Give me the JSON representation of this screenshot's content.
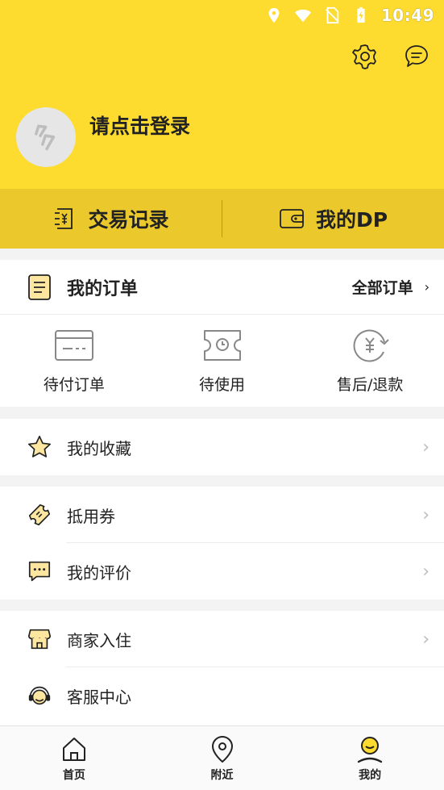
{
  "status_bar": {
    "time": "10:49"
  },
  "header": {
    "login_prompt": "请点击登录"
  },
  "quick_bar": {
    "left_label": "交易记录",
    "right_label": "我的DP"
  },
  "orders": {
    "title": "我的订单",
    "all_label": "全部订单",
    "items": [
      {
        "label": "待付订单",
        "icon": "card-icon"
      },
      {
        "label": "待使用",
        "icon": "ticket-clock-icon"
      },
      {
        "label": "售后/退款",
        "icon": "refund-icon"
      }
    ]
  },
  "menu": {
    "favorites": "我的收藏",
    "vouchers": "抵用券",
    "reviews": "我的评价",
    "merchant": "商家入住",
    "service": "客服中心"
  },
  "tabbar": {
    "home": "首页",
    "nearby": "附近",
    "mine": "我的"
  },
  "colors": {
    "brand_yellow": "#fddb2f",
    "quickbar_yellow": "#ebc92c",
    "icon_fill": "#fde7a0"
  }
}
